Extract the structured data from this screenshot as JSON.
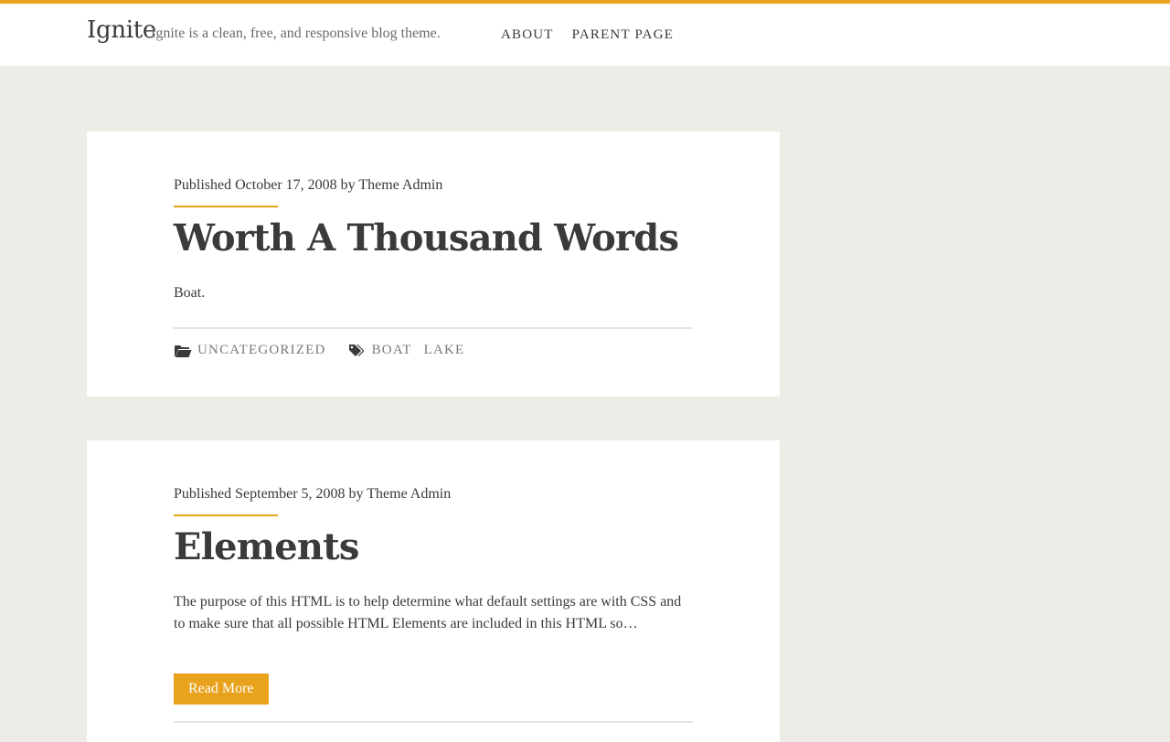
{
  "header": {
    "site_title": "Ignite",
    "tagline": "Ignite is a clean, free, and responsive blog theme.",
    "nav": [
      {
        "label": "ABOUT"
      },
      {
        "label": "PARENT PAGE"
      }
    ]
  },
  "posts": [
    {
      "published_prefix": "Published",
      "date": "October 17, 2008",
      "by": "by",
      "author": "Theme Admin",
      "title": "Worth A Thousand Words",
      "excerpt": "Boat.",
      "category": "UNCATEGORIZED",
      "tags": [
        "BOAT",
        "LAKE"
      ]
    },
    {
      "published_prefix": "Published",
      "date": "September 5, 2008",
      "by": "by",
      "author": "Theme Admin",
      "title": "Elements",
      "excerpt": "The purpose of this HTML is to help determine what default settings are with CSS and to make sure that all possible HTML Elements are included in this HTML so…",
      "read_more": "Read More"
    }
  ],
  "icons": {
    "category": "folder-open-icon",
    "tags": "tags-icon"
  },
  "colors": {
    "accent": "#e8a21c",
    "background": "#edece7",
    "card": "#ffffff",
    "text": "#3a3a3a"
  }
}
